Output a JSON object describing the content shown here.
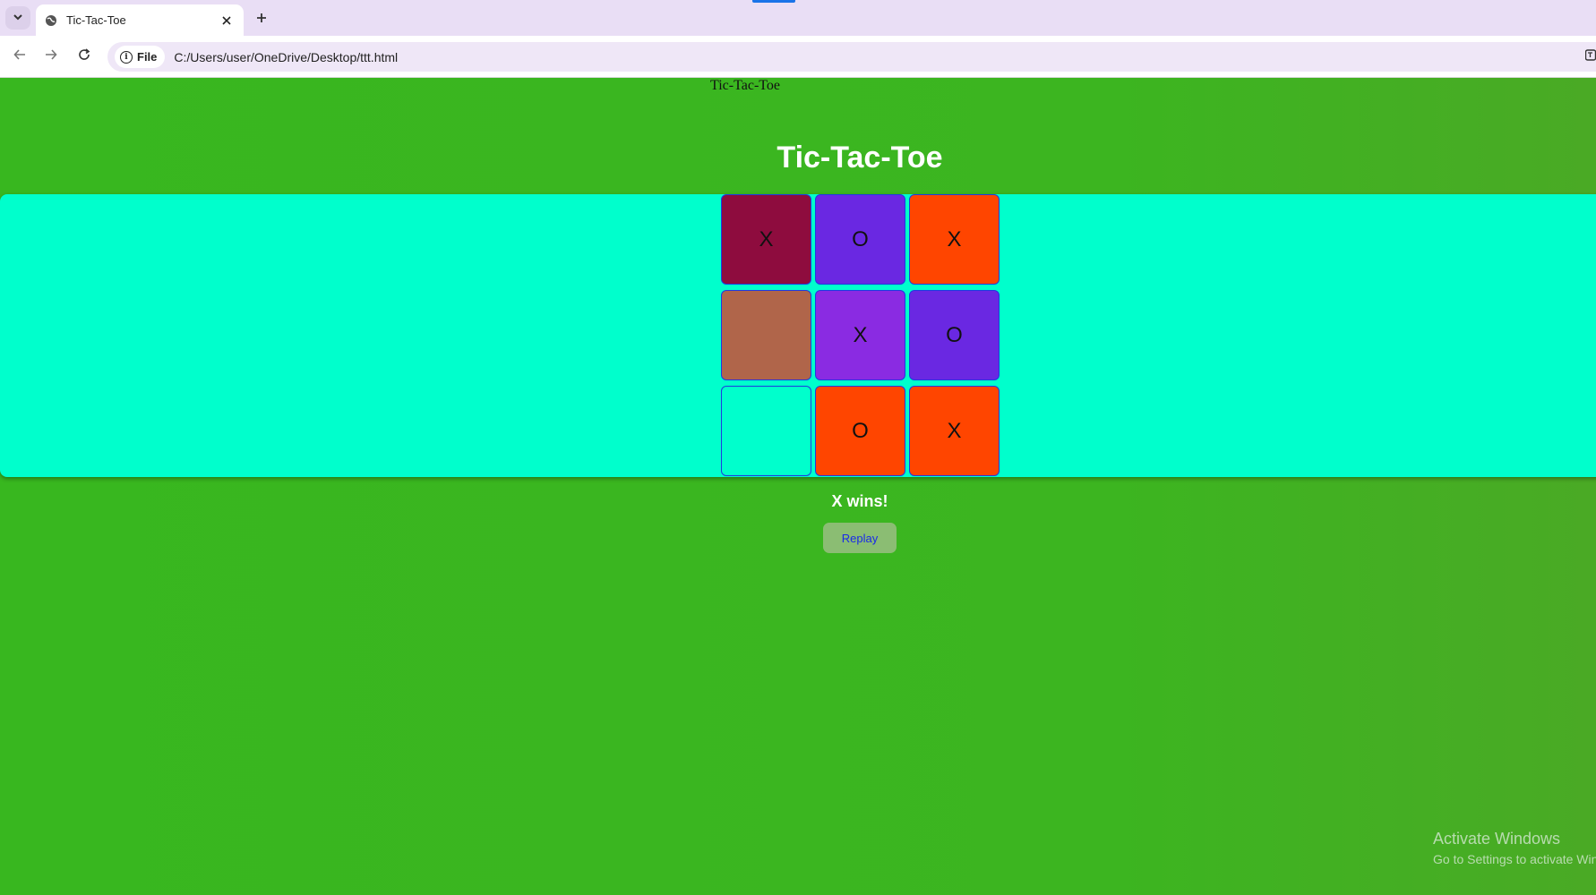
{
  "browser": {
    "tab_title": "Tic-Tac-Toe",
    "address_chip_label": "File",
    "url": "C:/Users/user/OneDrive/Desktop/ttt.html",
    "tab_list_icon": "chevron-down-icon",
    "new_tab_icon": "plus-icon",
    "close_tab_icon": "close-icon",
    "back_icon": "arrow-left-icon",
    "forward_icon": "arrow-right-icon",
    "reload_icon": "reload-icon",
    "info_icon": "info-icon",
    "translate_icon": "translate-icon"
  },
  "page": {
    "doc_title_text": "Tic-Tac-Toe",
    "heading": "Tic-Tac-Toe",
    "background_color": "#3cb520",
    "board_band_color": "#00ffcc",
    "board": [
      {
        "mark": "X",
        "color": "#8e0c3e"
      },
      {
        "mark": "O",
        "color": "#6a28e2"
      },
      {
        "mark": "X",
        "color": "#ff4500"
      },
      {
        "mark": "",
        "color": "#b0654a"
      },
      {
        "mark": "X",
        "color": "#8a2be2"
      },
      {
        "mark": "O",
        "color": "#6a28e2"
      },
      {
        "mark": "",
        "color": "#00ffcc"
      },
      {
        "mark": "O",
        "color": "#ff4500"
      },
      {
        "mark": "X",
        "color": "#ff4500"
      }
    ],
    "status": "X wins!",
    "replay_label": "Replay"
  },
  "watermark": {
    "title": "Activate Windows",
    "subtitle": "Go to Settings to activate Windows."
  }
}
